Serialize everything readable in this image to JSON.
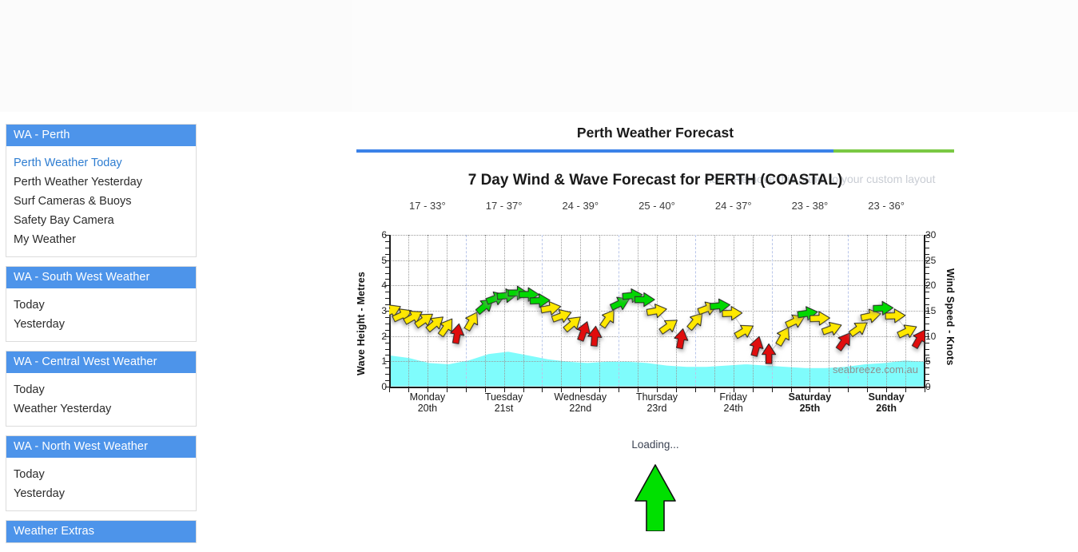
{
  "sidebar": {
    "panels": [
      {
        "title": "WA - Perth",
        "items": [
          {
            "label": "Perth Weather Today",
            "active": true
          },
          {
            "label": "Perth Weather Yesterday",
            "active": false
          },
          {
            "label": "Surf Cameras & Buoys",
            "active": false
          },
          {
            "label": "Safety Bay Camera",
            "active": false
          },
          {
            "label": "My Weather",
            "active": false
          }
        ]
      },
      {
        "title": "WA - South West Weather",
        "items": [
          {
            "label": "Today",
            "active": false
          },
          {
            "label": "Yesterday",
            "active": false
          }
        ]
      },
      {
        "title": "WA - Central West Weather",
        "items": [
          {
            "label": "Today",
            "active": false
          },
          {
            "label": "Weather Yesterday",
            "active": false
          }
        ]
      },
      {
        "title": "WA - North West Weather",
        "items": [
          {
            "label": "Today",
            "active": false
          },
          {
            "label": "Yesterday",
            "active": false
          }
        ]
      },
      {
        "title": "Weather Extras",
        "items": []
      }
    ]
  },
  "header": {
    "title": "Perth Weather Forecast",
    "rule_blue": "#3b82e8",
    "rule_green": "#7ac943"
  },
  "main": {
    "subtitle": "7 Day Wind & Wave Forecast for PERTH (COASTAL)",
    "custom_layout_text": "Add / Remove this panel to your custom layout",
    "watermark": "seabreeze.com.au",
    "loading_text": "Loading...",
    "loading_arrow_color": "#00e000"
  },
  "chart_data": {
    "type": "line",
    "title": "7 Day Wind & Wave Forecast for PERTH (COASTAL)",
    "xlabel": "",
    "ylabel": "Wave Height - Metres",
    "y2label": "Wind Speed - Knots",
    "ylim": [
      0,
      6
    ],
    "y2lim": [
      0,
      30
    ],
    "yticks": [
      "0",
      "1",
      "2",
      "3",
      "4",
      "5",
      "6"
    ],
    "y2ticks": [
      "0",
      "5",
      "10",
      "15",
      "20",
      "25",
      "30"
    ],
    "grid": true,
    "legend": "none",
    "categories": [
      {
        "dow": "Monday",
        "dom": "20th",
        "temps": "17 - 33°",
        "weekend": false
      },
      {
        "dow": "Tuesday",
        "dom": "21st",
        "temps": "17 - 37°",
        "weekend": false
      },
      {
        "dow": "Wednesday",
        "dom": "22nd",
        "temps": "24 - 39°",
        "weekend": false
      },
      {
        "dow": "Thursday",
        "dom": "23rd",
        "temps": "25 - 40°",
        "weekend": false
      },
      {
        "dow": "Friday",
        "dom": "24th",
        "temps": "24 - 37°",
        "weekend": false
      },
      {
        "dow": "Saturday",
        "dom": "25th",
        "temps": "23 - 38°",
        "weekend": true
      },
      {
        "dow": "Sunday",
        "dom": "26th",
        "temps": "23 - 36°",
        "weekend": true
      }
    ],
    "series": [
      {
        "name": "Wave Height - Metres",
        "axis": "left",
        "type": "area",
        "color": "#7ffcfc",
        "values": [
          1.25,
          1.15,
          0.95,
          0.9,
          1.05,
          1.3,
          1.4,
          1.25,
          1.1,
          1.0,
          0.95,
          1.0,
          1.0,
          0.95,
          0.85,
          0.8,
          0.8,
          0.85,
          0.9,
          0.85,
          0.8,
          0.75,
          0.75,
          0.8,
          0.9,
          0.95,
          1.05,
          1.0
        ]
      },
      {
        "name": "Wind Speed - Knots",
        "axis": "right",
        "type": "arrows",
        "arrow_colors": {
          "low": "#ffe800",
          "high": "#00d800",
          "offshore": "#e01010"
        },
        "points": [
          {
            "x": 0.1,
            "knots": 15.0,
            "dir": 245,
            "cat": "low"
          },
          {
            "x": 0.55,
            "knots": 14.2,
            "dir": 245,
            "cat": "low"
          },
          {
            "x": 1.0,
            "knots": 13.8,
            "dir": 240,
            "cat": "low"
          },
          {
            "x": 1.45,
            "knots": 13.2,
            "dir": 235,
            "cat": "low"
          },
          {
            "x": 1.9,
            "knots": 12.5,
            "dir": 230,
            "cat": "low"
          },
          {
            "x": 2.35,
            "knots": 11.8,
            "dir": 215,
            "cat": "low"
          },
          {
            "x": 2.8,
            "knots": 10.5,
            "dir": 190,
            "cat": "offshore"
          },
          {
            "x": 3.4,
            "knots": 13.0,
            "dir": 210,
            "cat": "low"
          },
          {
            "x": 3.95,
            "knots": 16.0,
            "dir": 230,
            "cat": "high"
          },
          {
            "x": 4.4,
            "knots": 17.5,
            "dir": 250,
            "cat": "high"
          },
          {
            "x": 4.85,
            "knots": 18.0,
            "dir": 265,
            "cat": "high"
          },
          {
            "x": 5.3,
            "knots": 18.5,
            "dir": 270,
            "cat": "high"
          },
          {
            "x": 5.75,
            "knots": 18.2,
            "dir": 270,
            "cat": "high"
          },
          {
            "x": 6.2,
            "knots": 17.0,
            "dir": 268,
            "cat": "high"
          },
          {
            "x": 6.65,
            "knots": 15.5,
            "dir": 260,
            "cat": "low"
          },
          {
            "x": 7.1,
            "knots": 14.0,
            "dir": 250,
            "cat": "low"
          },
          {
            "x": 7.55,
            "knots": 12.5,
            "dir": 230,
            "cat": "low"
          },
          {
            "x": 8.0,
            "knots": 11.0,
            "dir": 200,
            "cat": "offshore"
          },
          {
            "x": 8.45,
            "knots": 10.0,
            "dir": 185,
            "cat": "offshore"
          },
          {
            "x": 9.0,
            "knots": 13.5,
            "dir": 215,
            "cat": "low"
          },
          {
            "x": 9.5,
            "knots": 16.5,
            "dir": 245,
            "cat": "high"
          },
          {
            "x": 10.0,
            "knots": 18.0,
            "dir": 265,
            "cat": "high"
          },
          {
            "x": 10.5,
            "knots": 17.2,
            "dir": 270,
            "cat": "high"
          },
          {
            "x": 11.0,
            "knots": 15.0,
            "dir": 260,
            "cat": "low"
          },
          {
            "x": 11.5,
            "knots": 12.0,
            "dir": 235,
            "cat": "low"
          },
          {
            "x": 12.0,
            "knots": 9.5,
            "dir": 190,
            "cat": "offshore"
          },
          {
            "x": 12.6,
            "knots": 13.0,
            "dir": 220,
            "cat": "low"
          },
          {
            "x": 13.1,
            "knots": 15.5,
            "dir": 250,
            "cat": "low"
          },
          {
            "x": 13.6,
            "knots": 16.0,
            "dir": 265,
            "cat": "high"
          },
          {
            "x": 14.1,
            "knots": 14.5,
            "dir": 268,
            "cat": "low"
          },
          {
            "x": 14.6,
            "knots": 11.0,
            "dir": 240,
            "cat": "low"
          },
          {
            "x": 15.1,
            "knots": 8.0,
            "dir": 195,
            "cat": "offshore"
          },
          {
            "x": 15.6,
            "knots": 6.5,
            "dir": 180,
            "cat": "offshore"
          },
          {
            "x": 16.2,
            "knots": 10.0,
            "dir": 210,
            "cat": "low"
          },
          {
            "x": 16.7,
            "knots": 13.0,
            "dir": 245,
            "cat": "low"
          },
          {
            "x": 17.2,
            "knots": 14.5,
            "dir": 262,
            "cat": "high"
          },
          {
            "x": 17.7,
            "knots": 13.5,
            "dir": 268,
            "cat": "low"
          },
          {
            "x": 18.2,
            "knots": 11.5,
            "dir": 250,
            "cat": "low"
          },
          {
            "x": 18.7,
            "knots": 9.0,
            "dir": 215,
            "cat": "offshore"
          },
          {
            "x": 19.3,
            "knots": 11.5,
            "dir": 235,
            "cat": "low"
          },
          {
            "x": 19.8,
            "knots": 14.0,
            "dir": 258,
            "cat": "low"
          },
          {
            "x": 20.3,
            "knots": 15.5,
            "dir": 268,
            "cat": "high"
          },
          {
            "x": 20.8,
            "knots": 14.0,
            "dir": 268,
            "cat": "low"
          },
          {
            "x": 21.3,
            "knots": 11.0,
            "dir": 245,
            "cat": "low"
          },
          {
            "x": 21.8,
            "knots": 9.5,
            "dir": 210,
            "cat": "offshore"
          }
        ]
      }
    ]
  }
}
